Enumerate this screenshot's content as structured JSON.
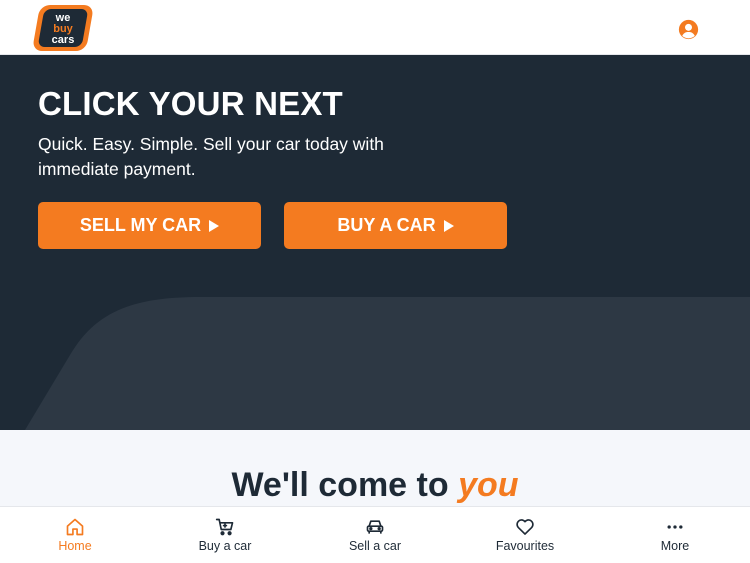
{
  "colors": {
    "brand_orange": "#f47b20",
    "dark_navy": "#1e2a36",
    "hero_shape": "#2d3844",
    "section_bg": "#f5f7fb"
  },
  "header": {
    "logo_lines": [
      "we",
      "buy",
      "cars"
    ],
    "account_icon": "user-circle-icon"
  },
  "hero": {
    "headline": "CLICK YOUR NEXT",
    "subline": "Quick. Easy. Simple. Sell your car today with immediate payment.",
    "sell_button": "SELL MY CAR",
    "buy_button": "BUY A CAR"
  },
  "section": {
    "title_main": "We'll come to ",
    "title_accent": "you"
  },
  "bottom_nav": {
    "items": [
      {
        "label": "Home",
        "icon": "home-icon",
        "active": true
      },
      {
        "label": "Buy a car",
        "icon": "cart-icon",
        "active": false
      },
      {
        "label": "Sell a car",
        "icon": "car-icon",
        "active": false
      },
      {
        "label": "Favourites",
        "icon": "heart-icon",
        "active": false
      },
      {
        "label": "More",
        "icon": "more-icon",
        "active": false
      }
    ]
  }
}
